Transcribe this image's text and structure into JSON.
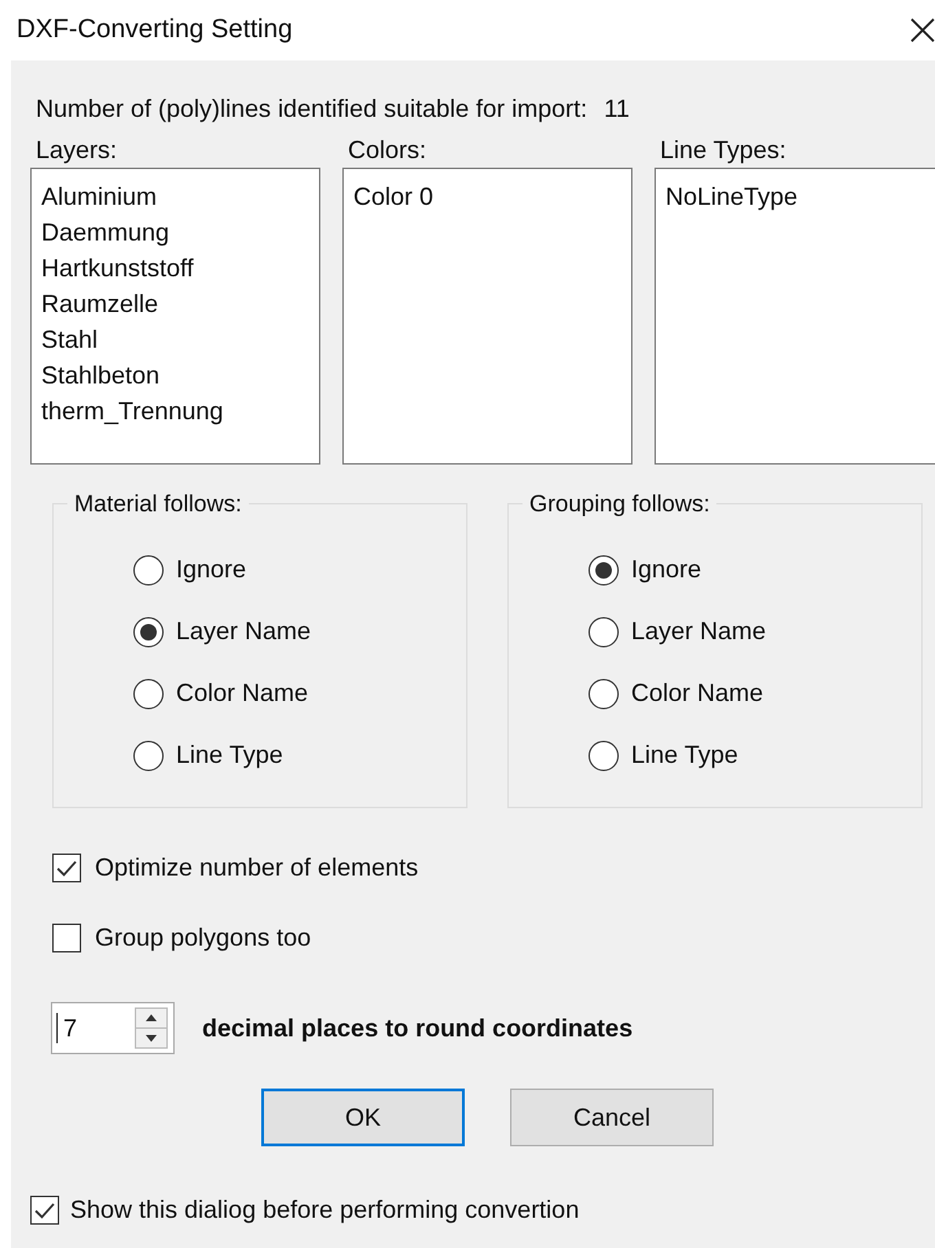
{
  "window": {
    "title": "DXF-Converting Setting"
  },
  "count": {
    "label": "Number of (poly)lines identified suitable for import:",
    "value": "11"
  },
  "lists": [
    {
      "label": "Layers:",
      "items": [
        "Aluminium",
        "Daemmung",
        "Hartkunststoff",
        "Raumzelle",
        "Stahl",
        "Stahlbeton",
        "therm_Trennung"
      ]
    },
    {
      "label": "Colors:",
      "items": [
        "Color 0"
      ]
    },
    {
      "label": "Line Types:",
      "items": [
        "NoLineType"
      ]
    }
  ],
  "groups": [
    {
      "title": "Material follows:",
      "options": [
        {
          "label": "Ignore",
          "selected": false
        },
        {
          "label": "Layer Name",
          "selected": true
        },
        {
          "label": "Color Name",
          "selected": false
        },
        {
          "label": "Line Type",
          "selected": false
        }
      ]
    },
    {
      "title": "Grouping follows:",
      "options": [
        {
          "label": "Ignore",
          "selected": true
        },
        {
          "label": "Layer Name",
          "selected": false
        },
        {
          "label": "Color Name",
          "selected": false
        },
        {
          "label": "Line Type",
          "selected": false
        }
      ]
    }
  ],
  "options": [
    {
      "label": "Optimize number of elements",
      "checked": true
    },
    {
      "label": "Group polygons too",
      "checked": false
    }
  ],
  "decimals": {
    "value": "7",
    "label": "decimal places to round coordinates"
  },
  "buttons": [
    {
      "label": "OK",
      "default": true
    },
    {
      "label": "Cancel",
      "default": false
    }
  ],
  "show_dialog": {
    "label": "Show this dialiog before performing convertion",
    "checked": true
  }
}
